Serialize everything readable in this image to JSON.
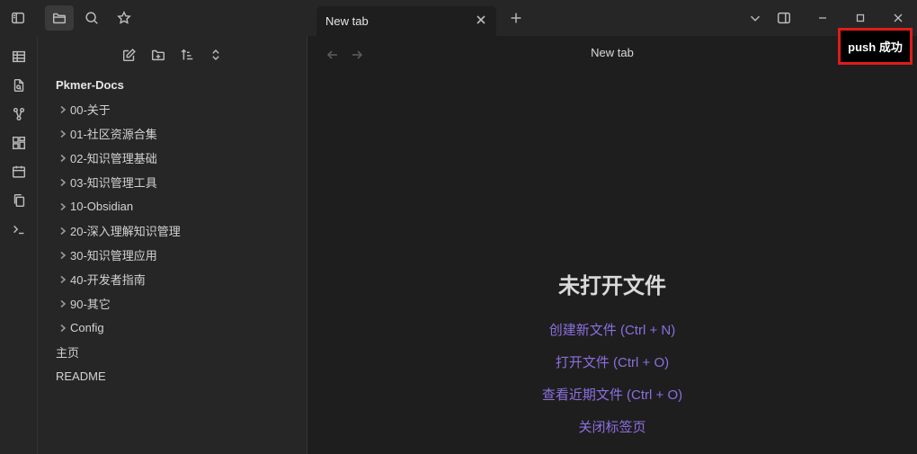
{
  "titlebar": {
    "tab_title": "New tab"
  },
  "sidebar": {
    "vault_name": "Pkmer-Docs",
    "items": [
      {
        "label": "00-关于",
        "type": "folder"
      },
      {
        "label": "01-社区资源合集",
        "type": "folder"
      },
      {
        "label": "02-知识管理基础",
        "type": "folder"
      },
      {
        "label": "03-知识管理工具",
        "type": "folder"
      },
      {
        "label": "10-Obsidian",
        "type": "folder"
      },
      {
        "label": "20-深入理解知识管理",
        "type": "folder"
      },
      {
        "label": "30-知识管理应用",
        "type": "folder"
      },
      {
        "label": "40-开发者指南",
        "type": "folder"
      },
      {
        "label": "90-其它",
        "type": "folder"
      },
      {
        "label": "Config",
        "type": "folder"
      },
      {
        "label": "主页",
        "type": "file"
      },
      {
        "label": "README",
        "type": "file"
      }
    ]
  },
  "main": {
    "view_title": "New tab",
    "empty_title": "未打开文件",
    "actions": [
      "创建新文件 (Ctrl + N)",
      "打开文件 (Ctrl + O)",
      "查看近期文件 (Ctrl + O)",
      "关闭标签页"
    ]
  },
  "notice": {
    "text": "push 成功"
  },
  "colors": {
    "accent": "#8c6fe0",
    "notice_border": "#e01b1b",
    "sidebar_bg": "#262626",
    "main_bg": "#1e1e1e"
  }
}
